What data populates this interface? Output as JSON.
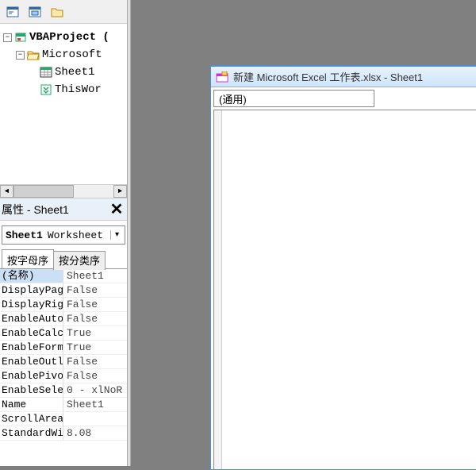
{
  "project_tree": {
    "root_label": "VBAProject (",
    "folder_label": "Microsoft",
    "sheet_label": "Sheet1",
    "workbook_label": "ThisWor"
  },
  "properties": {
    "header": "属性 - Sheet1",
    "selector": {
      "name": "Sheet1",
      "type": "Worksheet"
    },
    "tabs": {
      "alpha": "按字母序",
      "category": "按分类序"
    },
    "rows": [
      {
        "name": "(名称)",
        "value": "Sheet1",
        "selected": true
      },
      {
        "name": "DisplayPag",
        "value": "False"
      },
      {
        "name": "DisplayRig",
        "value": "False"
      },
      {
        "name": "EnableAuto",
        "value": "False"
      },
      {
        "name": "EnableCalc",
        "value": "True"
      },
      {
        "name": "EnableForm",
        "value": "True"
      },
      {
        "name": "EnableOutl",
        "value": "False"
      },
      {
        "name": "EnablePivo",
        "value": "False"
      },
      {
        "name": "EnableSele",
        "value": "0 - xlNoR"
      },
      {
        "name": "Name",
        "value": "Sheet1"
      },
      {
        "name": "ScrollArea",
        "value": ""
      },
      {
        "name": "StandardWi",
        "value": "8.08"
      }
    ]
  },
  "code_window": {
    "title": "新建 Microsoft Excel 工作表.xlsx - Sheet1",
    "dropdown": "(通用)"
  }
}
